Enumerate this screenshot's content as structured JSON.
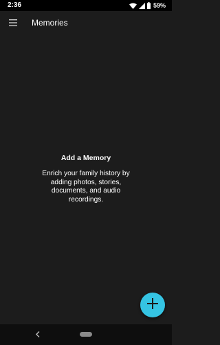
{
  "status_bar": {
    "time": "2:36",
    "battery": "59%",
    "icons": [
      "wifi-icon",
      "signal-icon",
      "battery-icon"
    ]
  },
  "app_bar": {
    "menu_icon": "hamburger-menu-icon",
    "title": "Memories"
  },
  "empty_state": {
    "title": "Add a Memory",
    "body": "Enrich your family history by adding photos, stories, documents, and audio recordings."
  },
  "fab": {
    "icon": "plus-icon",
    "color": "#35c4e3"
  },
  "nav_bar": {
    "back_icon": "back-chevron-icon",
    "home_icon": "home-pill-icon"
  },
  "colors": {
    "background": "#1c1c1c",
    "status_bar": "#000000",
    "nav_bar": "#0e0e0e",
    "accent": "#35c4e3"
  }
}
